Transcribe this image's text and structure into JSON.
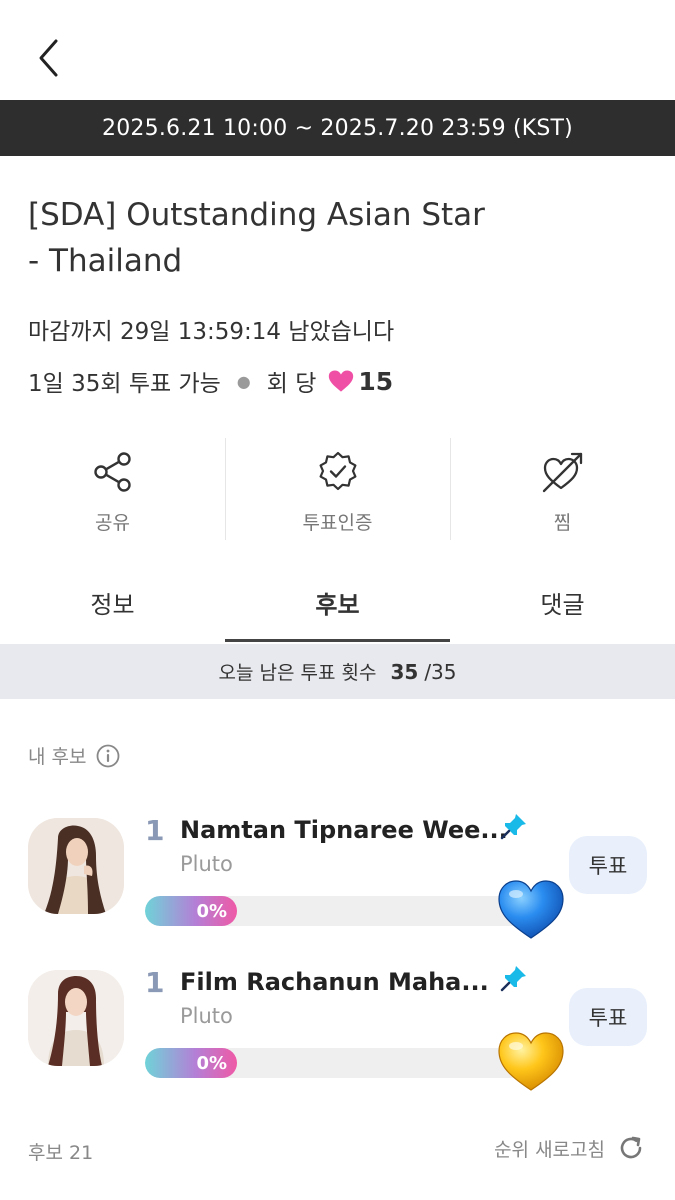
{
  "header": {
    "back_icon": "chevron-left-icon"
  },
  "period": "2025.6.21 10:00 ~ 2025.7.20 23:59 (KST)",
  "title_line1": "[SDA] Outstanding Asian Star",
  "title_line2": "- Thailand",
  "deadline": "마감까지 29일 13:59:14 남았습니다",
  "limit": {
    "daily": "1일 35회 투표 가능",
    "per_vote_label": "회 당",
    "per_vote_value": "15",
    "heart_color": "#f04fa6"
  },
  "actions": [
    {
      "label": "공유",
      "icon": "share-icon"
    },
    {
      "label": "투표인증",
      "icon": "verified-badge-icon"
    },
    {
      "label": "찜",
      "icon": "heart-arrow-icon"
    }
  ],
  "tabs": [
    {
      "label": "정보",
      "active": false
    },
    {
      "label": "후보",
      "active": true
    },
    {
      "label": "댓글",
      "active": false
    }
  ],
  "remaining": {
    "label": "오늘 남은 투표 횟수",
    "current": "35",
    "total": "/35"
  },
  "my_candidates": {
    "label": "내 후보",
    "icon": "info-icon"
  },
  "candidates": [
    {
      "rank": "1",
      "name": "Namtan Tipnaree Wee...",
      "agency": "Pluto",
      "percent": "0%",
      "progress": 0,
      "heart_color": "#1f7fe8",
      "vote_label": "투표"
    },
    {
      "rank": "1",
      "name": "Film Rachanun Maha...",
      "agency": "Pluto",
      "percent": "0%",
      "progress": 0,
      "heart_color": "#f2b800",
      "vote_label": "투표"
    }
  ],
  "footer": {
    "count": "후보 21",
    "refresh_label": "순위 새로고침",
    "refresh_icon": "refresh-icon"
  },
  "colors": {
    "period_bar": "#2e2e2e",
    "remaining_bg": "#e8e9ee",
    "rank": "#8a9ab6",
    "vote_button": "#e9f0fb"
  }
}
